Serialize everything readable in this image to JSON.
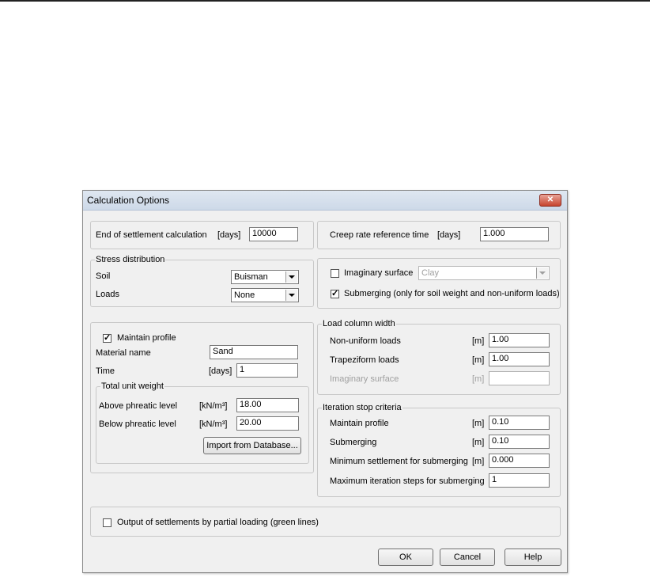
{
  "dialog": {
    "title": "Calculation Options",
    "close_glyph": "✕"
  },
  "end_settlement": {
    "label": "End of settlement calculation",
    "unit": "[days]",
    "value": "10000"
  },
  "creep": {
    "label": "Creep rate reference time",
    "unit": "[days]",
    "value": "1.000"
  },
  "stress_distribution": {
    "legend": "Stress distribution",
    "soil_label": "Soil",
    "soil_value": "Buisman",
    "loads_label": "Loads",
    "loads_value": "None"
  },
  "imaginary": {
    "label": "Imaginary surface",
    "checked": false,
    "value": "Clay",
    "submerging_label": "Submerging (only for soil weight and non-uniform loads)",
    "submerging_checked": true
  },
  "maintain_profile": {
    "label": "Maintain profile",
    "checked": true,
    "material_label": "Material name",
    "material_value": "Sand",
    "time_label": "Time",
    "time_unit": "[days]",
    "time_value": "1"
  },
  "unit_weight": {
    "legend": "Total unit weight",
    "above_label": "Above phreatic level",
    "above_unit": "[kN/m³]",
    "above_value": "18.00",
    "below_label": "Below phreatic level",
    "below_unit": "[kN/m³]",
    "below_value": "20.00",
    "import_label": "Import from Database..."
  },
  "load_column": {
    "legend": "Load column width",
    "nonuniform_label": "Non-uniform loads",
    "nonuniform_unit": "[m]",
    "nonuniform_value": "1.00",
    "trap_label": "Trapeziform loads",
    "trap_unit": "[m]",
    "trap_value": "1.00",
    "imag_label": "Imaginary surface",
    "imag_unit": "[m]",
    "imag_value": ""
  },
  "iteration": {
    "legend": "Iteration stop criteria",
    "maintain_label": "Maintain profile",
    "maintain_unit": "[m]",
    "maintain_value": "0.10",
    "sub_label": "Submerging",
    "sub_unit": "[m]",
    "sub_value": "0.10",
    "minset_label": "Minimum settlement for submerging",
    "minset_unit": "[m]",
    "minset_value": "0.000",
    "maxit_label": "Maximum iteration steps for submerging",
    "maxit_value": "1"
  },
  "output": {
    "label": "Output of settlements by partial loading (green lines)",
    "checked": false
  },
  "buttons": {
    "ok": "OK",
    "cancel": "Cancel",
    "help": "Help"
  }
}
